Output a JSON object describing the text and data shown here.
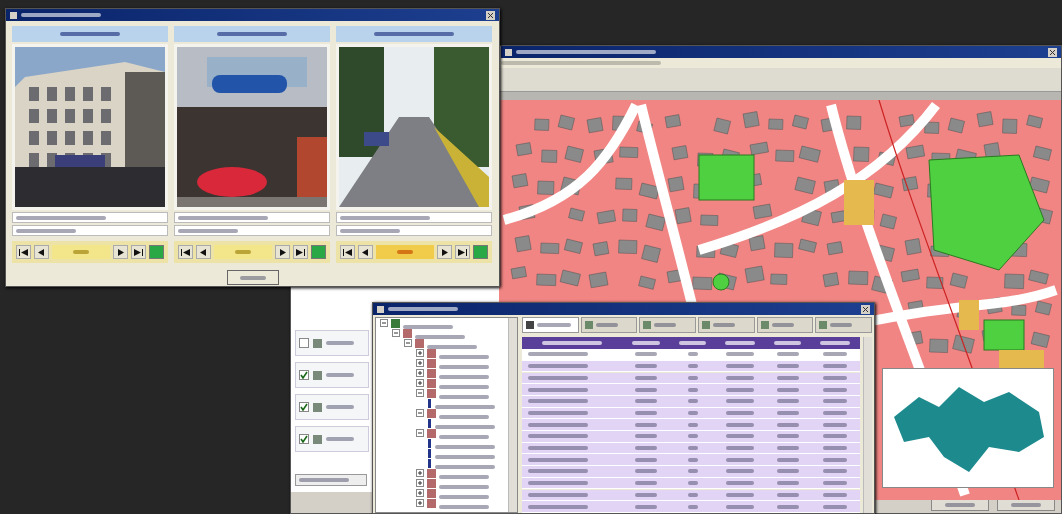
{
  "photo_window": {
    "panels": [
      {
        "kind": "building",
        "counter_active": false
      },
      {
        "kind": "shop",
        "counter_active": false
      },
      {
        "kind": "street",
        "counter_active": true
      }
    ]
  },
  "gis_window": {
    "layers": [
      {
        "checked": false
      },
      {
        "checked": true
      },
      {
        "checked": true
      },
      {
        "checked": true
      }
    ]
  },
  "attribute_window": {
    "tabs": [
      {
        "selected": true
      },
      {
        "selected": false
      },
      {
        "selected": false
      },
      {
        "selected": false
      },
      {
        "selected": false
      },
      {
        "selected": false
      }
    ],
    "tree": [
      {
        "expanded": true,
        "children": [
          {
            "expanded": true,
            "children": [
              {
                "expanded": true,
                "children": [
                  {
                    "expanded": false
                  },
                  {
                    "expanded": false
                  },
                  {
                    "expanded": false
                  },
                  {
                    "expanded": false
                  },
                  {
                    "expanded": true,
                    "children": [
                      {
                        "kind": "record"
                      }
                    ]
                  },
                  {
                    "expanded": true,
                    "children": [
                      {
                        "kind": "record"
                      }
                    ]
                  },
                  {
                    "expanded": true,
                    "children": [
                      {
                        "kind": "record"
                      },
                      {
                        "kind": "record"
                      },
                      {
                        "kind": "record"
                      }
                    ]
                  },
                  {
                    "expanded": false
                  },
                  {
                    "expanded": false
                  },
                  {
                    "expanded": false
                  },
                  {
                    "expanded": false
                  }
                ]
              }
            ]
          }
        ]
      }
    ],
    "table": {
      "rows": [
        {
          "selected": true
        },
        {
          "selected": false
        },
        {
          "selected": false
        },
        {
          "selected": false
        },
        {
          "selected": false
        },
        {
          "selected": false
        },
        {
          "selected": false
        },
        {
          "selected": false
        },
        {
          "selected": false
        },
        {
          "selected": false
        },
        {
          "selected": false
        },
        {
          "selected": false
        },
        {
          "selected": false
        },
        {
          "selected": false
        }
      ]
    }
  }
}
